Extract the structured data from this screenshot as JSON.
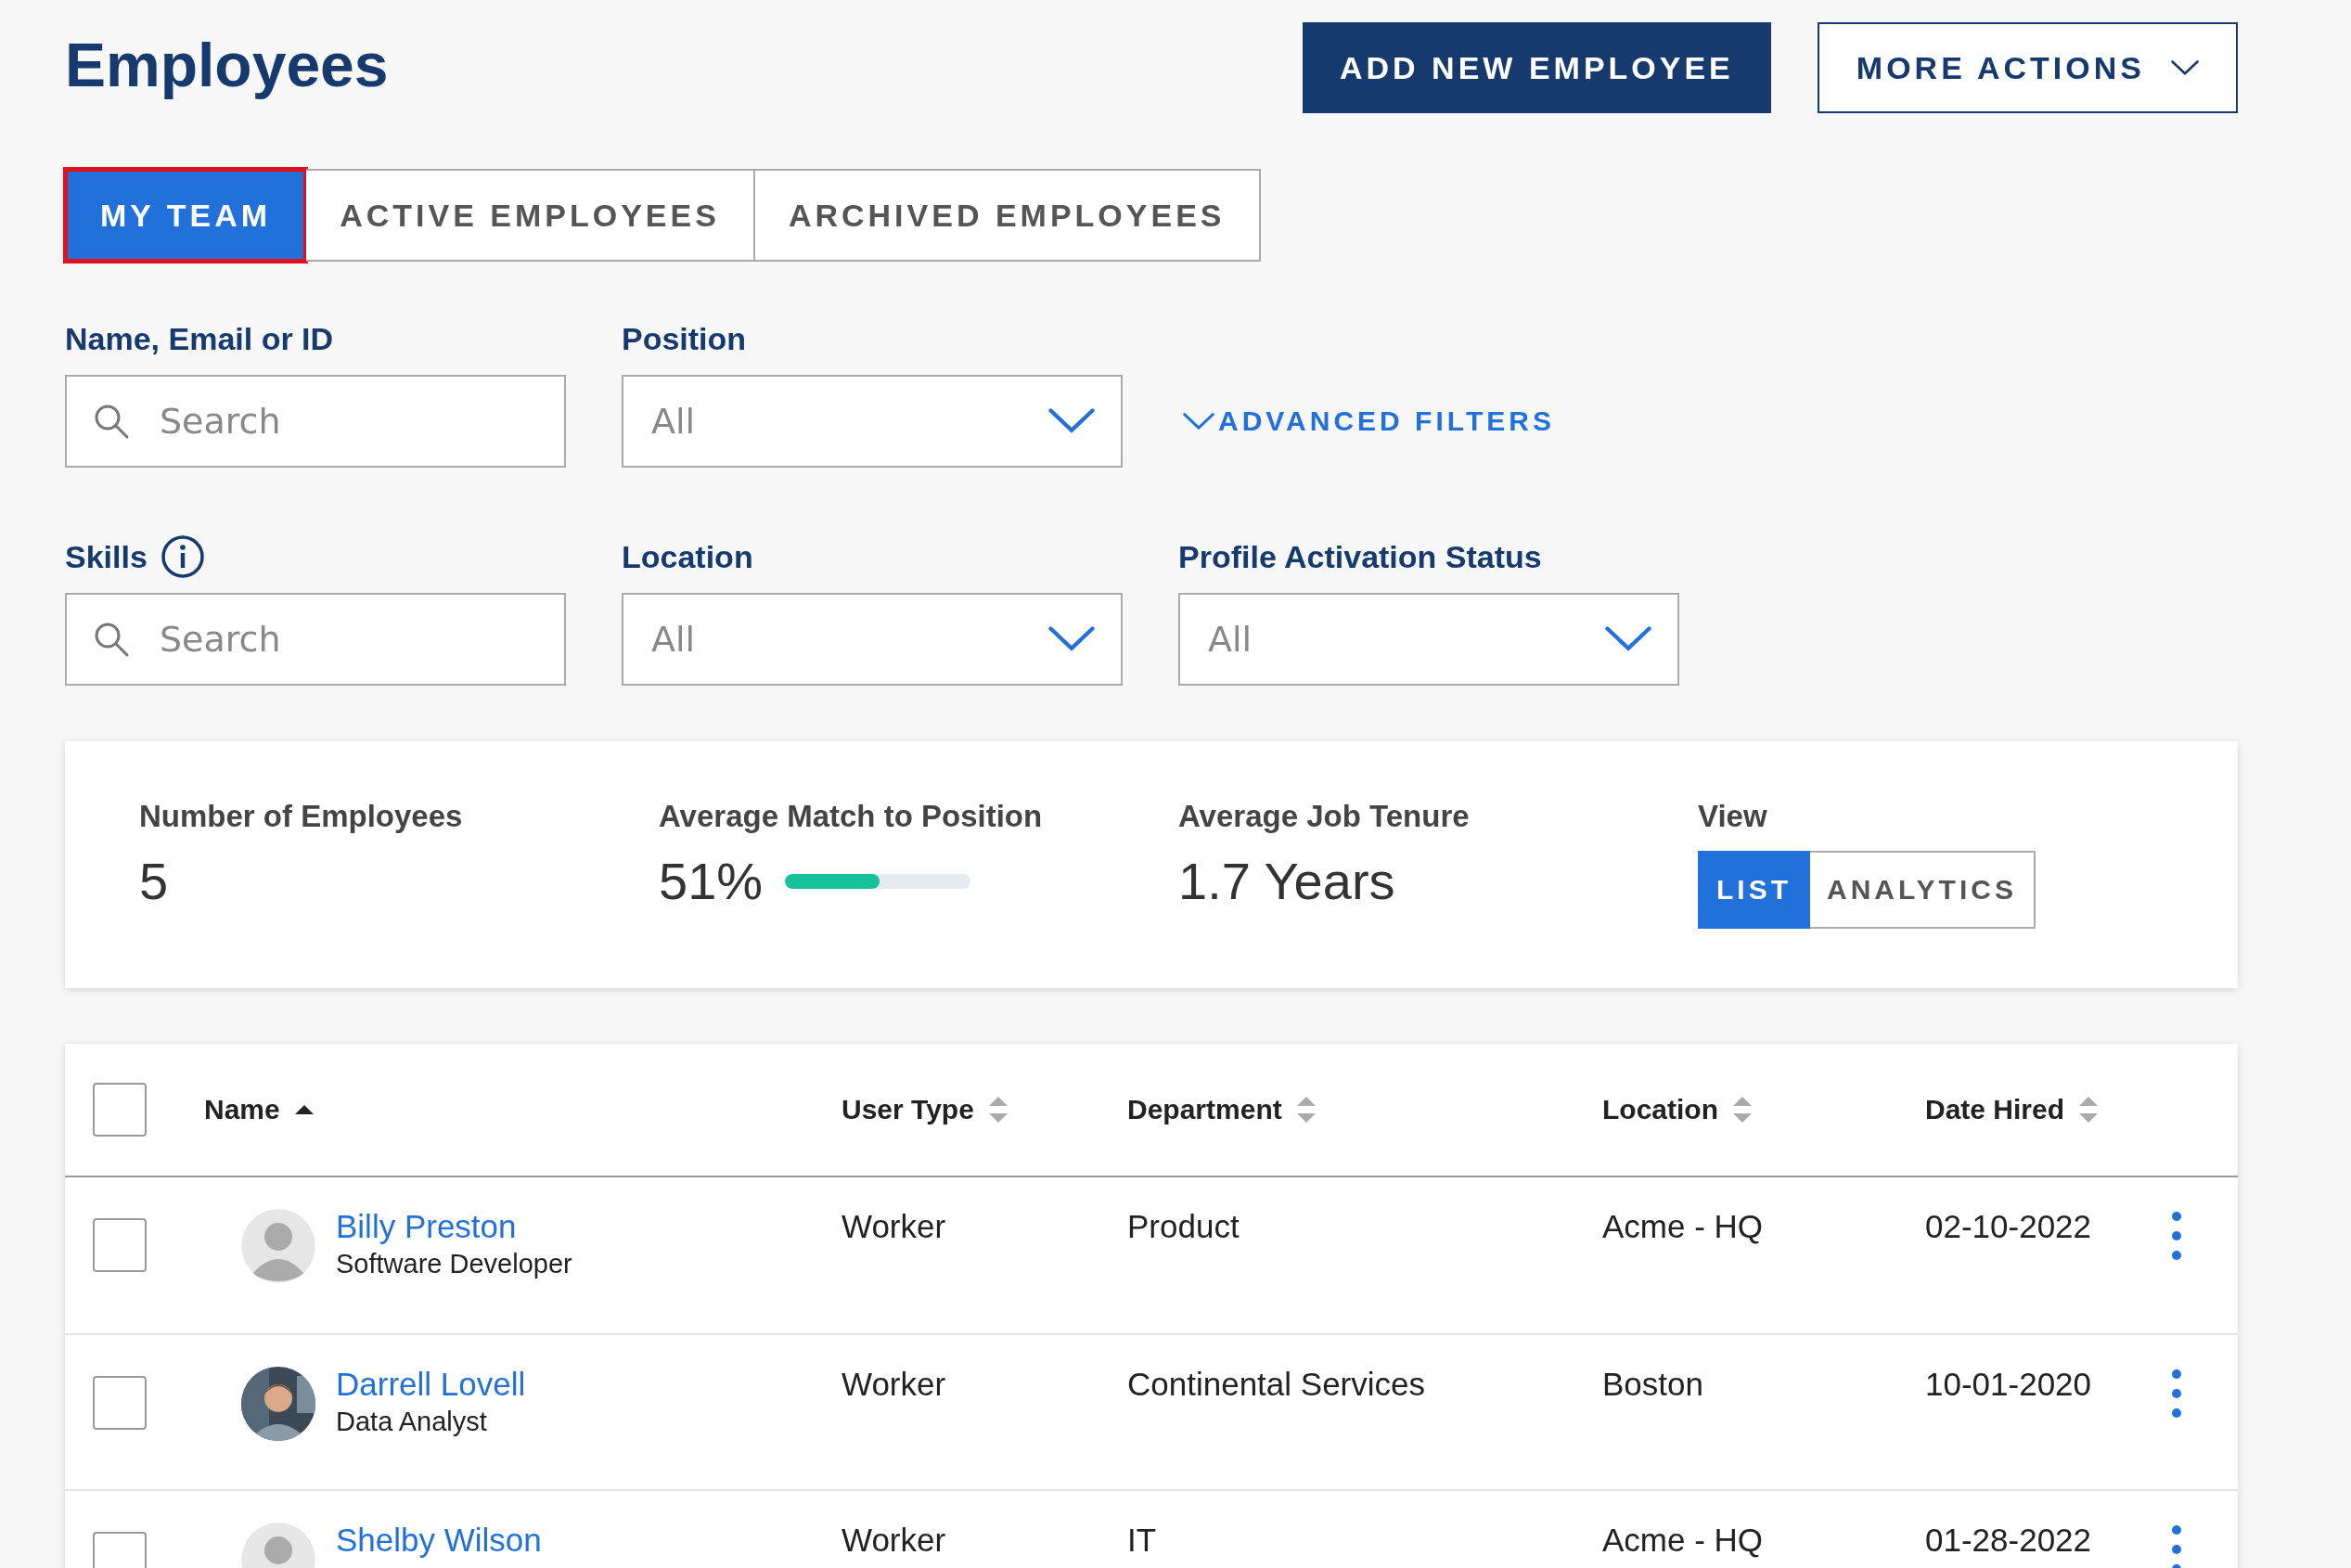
{
  "title": "Employees",
  "actions": [
    {
      "label": "ADD NEW EMPLOYEE",
      "kind": "primary"
    },
    {
      "label": "MORE ACTIONS",
      "kind": "menu"
    }
  ],
  "tabs": [
    {
      "label": "MY TEAM",
      "selected": true,
      "highlighted": true
    },
    {
      "label": "ACTIVE EMPLOYEES",
      "selected": false,
      "highlighted": false
    },
    {
      "label": "ARCHIVED EMPLOYEES",
      "selected": false,
      "highlighted": false
    }
  ],
  "filters": [
    {
      "label": "Name, Email or ID",
      "kind": "search",
      "placeholder": "Search"
    },
    {
      "label": "Position",
      "kind": "select",
      "value": "All"
    },
    {
      "label": "ADVANCED FILTERS",
      "kind": "link"
    },
    {
      "label": "Skills",
      "kind": "search",
      "info": true,
      "placeholder": "Search"
    },
    {
      "label": "Location",
      "kind": "select",
      "value": "All"
    },
    {
      "label": "Profile Activation Status",
      "kind": "select",
      "value": "All"
    }
  ],
  "summary": {
    "stats": [
      {
        "label": "Number of Employees",
        "value": "5",
        "kind": "text"
      },
      {
        "label": "Average Match to Position",
        "value": "51%",
        "kind": "meter",
        "level": 0.51
      },
      {
        "label": "Average Job Tenure",
        "value": "1.7 Years",
        "kind": "text"
      }
    ],
    "view": {
      "label": "View",
      "options": [
        {
          "label": "LIST",
          "selected": true
        },
        {
          "label": "ANALYTICS",
          "selected": false
        }
      ]
    }
  },
  "table": {
    "select_all": {
      "checked": false
    },
    "columns": [
      {
        "label": "Name",
        "kind": "ascending"
      },
      {
        "label": "User Type",
        "kind": "sortable"
      },
      {
        "label": "Department",
        "kind": "sortable"
      },
      {
        "label": "Location",
        "kind": "sortable"
      },
      {
        "label": "Date Hired",
        "kind": "sortable"
      }
    ],
    "rows": [
      {
        "checked": false,
        "avatar": {
          "kind": "placeholder"
        },
        "name": "Billy Preston",
        "role": "Software Developer",
        "user_type": "Worker",
        "department": "Product",
        "location": "Acme - HQ",
        "date_hired": "02-10-2022"
      },
      {
        "checked": false,
        "name": "Darrell Lovell",
        "role": "Data Analyst",
        "user_type": "Worker",
        "department": "Continental Services",
        "location": "Boston",
        "date_hired": "10-01-2020"
      },
      {
        "checked": false,
        "avatar": {
          "kind": "placeholder"
        },
        "name": "Shelby Wilson",
        "user_type": "Worker",
        "department": "IT",
        "location": "Acme - HQ",
        "date_hired": "01-28-2022"
      }
    ]
  }
}
